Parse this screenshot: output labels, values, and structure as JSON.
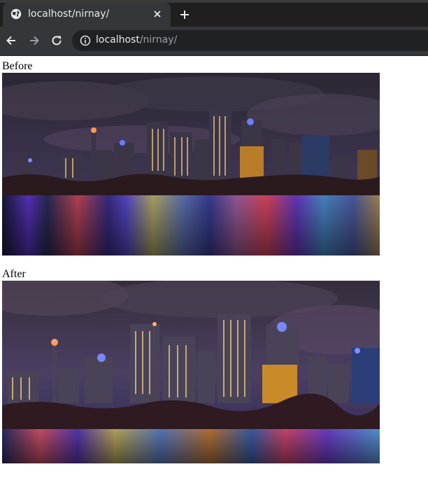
{
  "browser": {
    "tab_title": "localhost/nirnay/",
    "url_host": "localhost",
    "url_path": "/nirnay/",
    "icons": [
      "globe-icon",
      "close-icon",
      "plus-icon",
      "arrow-left-icon",
      "arrow-right-icon",
      "reload-icon",
      "info-icon"
    ]
  },
  "page": {
    "before_label": "Before",
    "after_label": "After",
    "images": [
      {
        "name": "before-image",
        "description_icon": "city-skyline-night-photo"
      },
      {
        "name": "after-image",
        "description_icon": "city-skyline-night-photo"
      }
    ]
  },
  "colors": {
    "tabstrip": "#1f1f1f",
    "toolbar": "#35363a",
    "omnibox": "#202124",
    "text_light": "#e8eaed",
    "text_dim": "#9aa0a6"
  }
}
